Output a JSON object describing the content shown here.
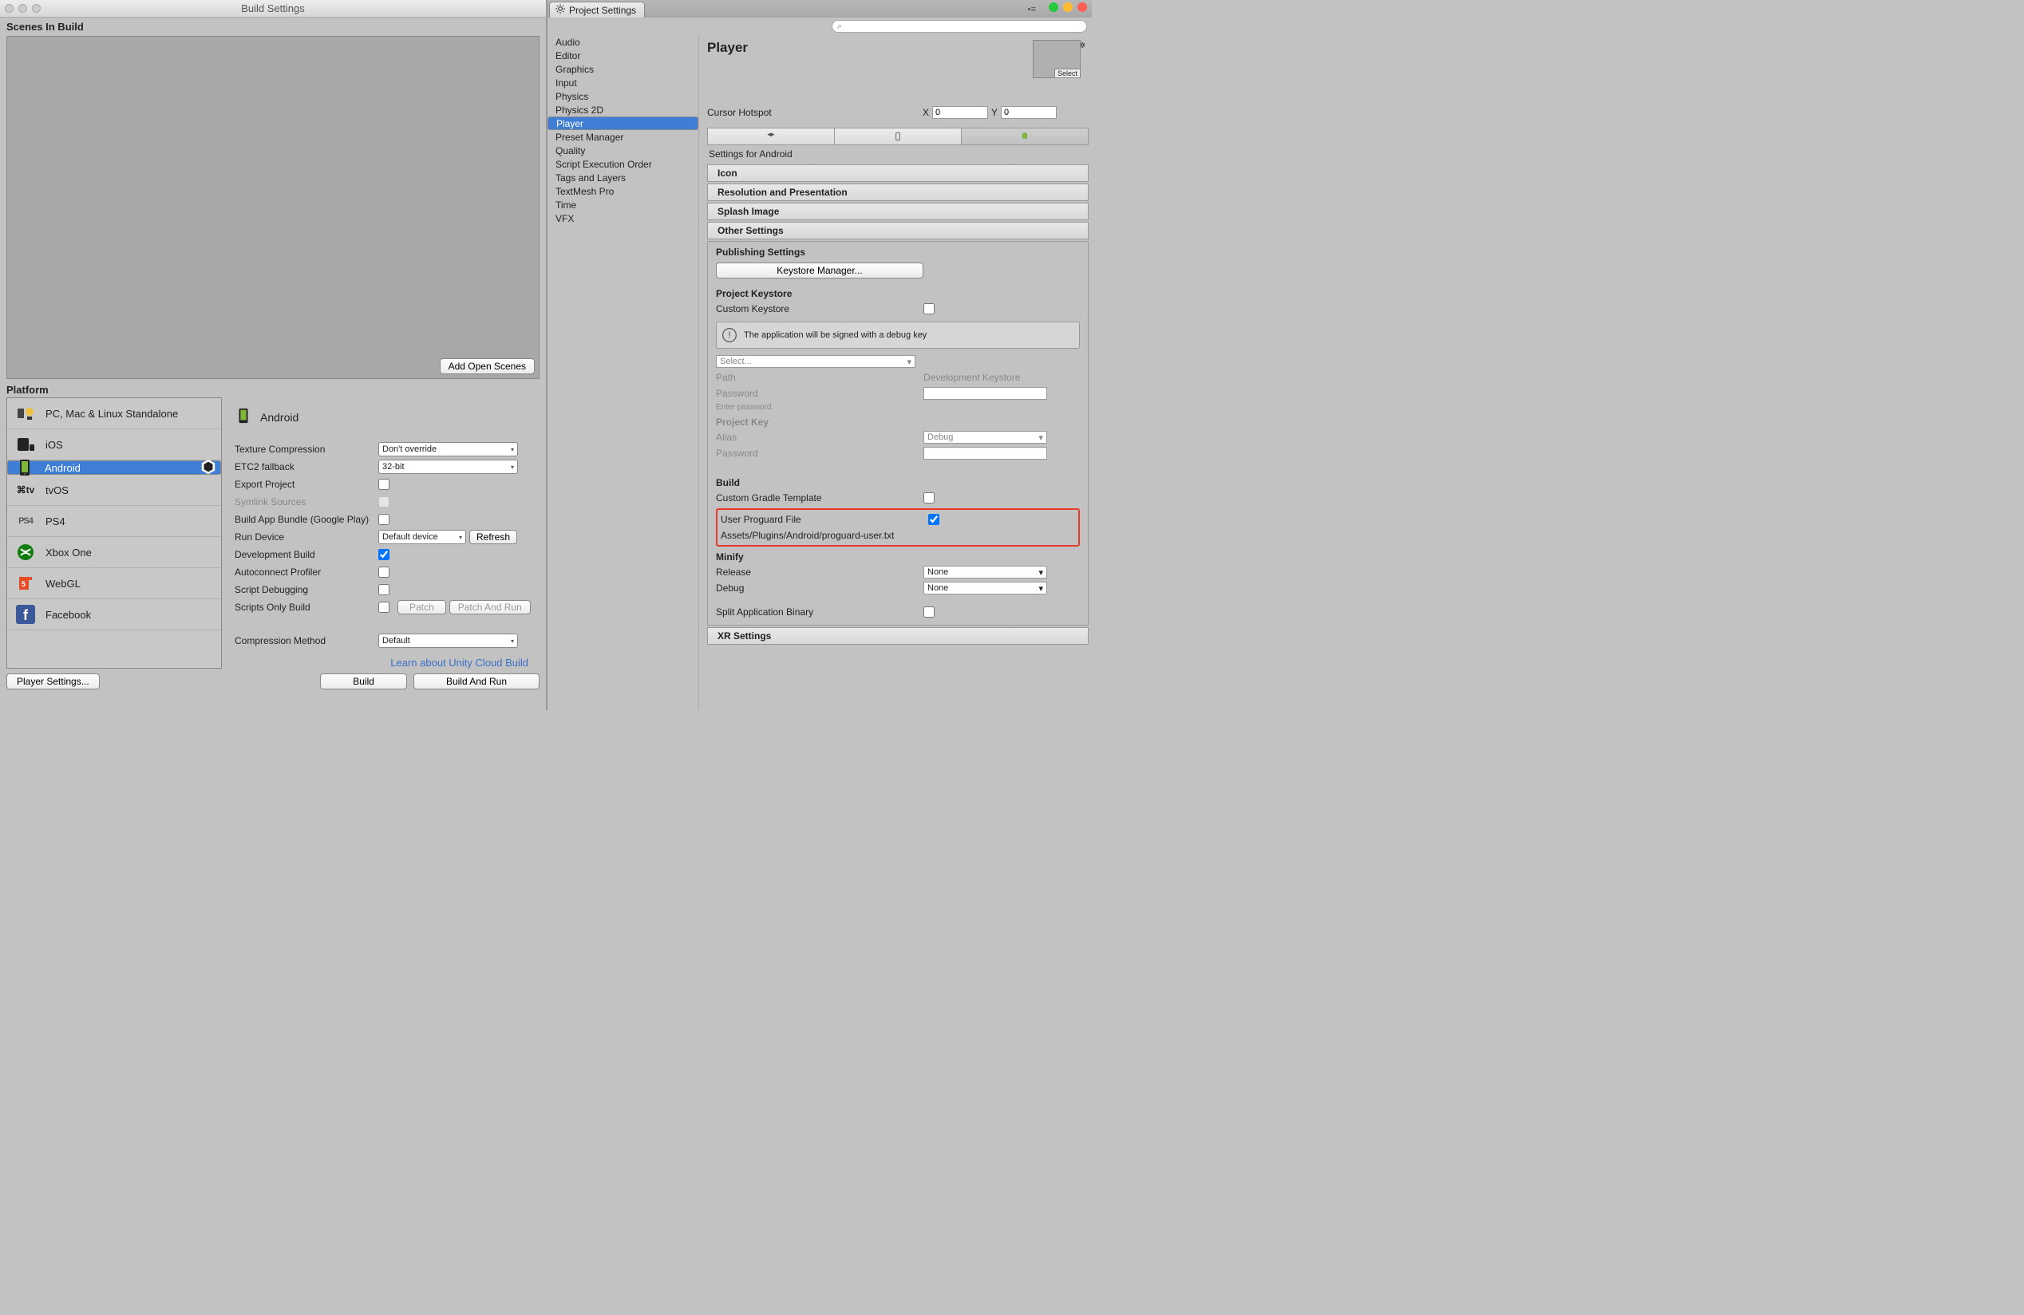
{
  "left": {
    "title": "Build Settings",
    "scenesLabel": "Scenes In Build",
    "addOpen": "Add Open Scenes",
    "platformLabel": "Platform",
    "platforms": [
      {
        "name": "PC, Mac & Linux Standalone"
      },
      {
        "name": "iOS"
      },
      {
        "name": "Android"
      },
      {
        "name": "tvOS"
      },
      {
        "name": "PS4"
      },
      {
        "name": "Xbox One"
      },
      {
        "name": "WebGL"
      },
      {
        "name": "Facebook"
      }
    ],
    "selectedPlatform": "Android",
    "opts": {
      "textureCompression": {
        "label": "Texture Compression",
        "value": "Don't override"
      },
      "etc2": {
        "label": "ETC2 fallback",
        "value": "32-bit"
      },
      "exportProject": {
        "label": "Export Project"
      },
      "symlink": {
        "label": "Symlink Sources"
      },
      "bundle": {
        "label": "Build App Bundle (Google Play)"
      },
      "runDevice": {
        "label": "Run Device",
        "value": "Default device",
        "refresh": "Refresh"
      },
      "devBuild": {
        "label": "Development Build"
      },
      "autoconnect": {
        "label": "Autoconnect Profiler"
      },
      "scriptDebug": {
        "label": "Script Debugging"
      },
      "scriptsOnly": {
        "label": "Scripts Only Build",
        "patch": "Patch",
        "patchRun": "Patch And Run"
      },
      "compression": {
        "label": "Compression Method",
        "value": "Default"
      }
    },
    "cloudLink": "Learn about Unity Cloud Build",
    "playerSettings": "Player Settings...",
    "build": "Build",
    "buildRun": "Build And Run"
  },
  "right": {
    "tabTitle": "Project Settings",
    "search": "",
    "searchIcon": "⌕",
    "categories": [
      "Audio",
      "Editor",
      "Graphics",
      "Input",
      "Physics",
      "Physics 2D",
      "Player",
      "Preset Manager",
      "Quality",
      "Script Execution Order",
      "Tags and Layers",
      "TextMesh Pro",
      "Time",
      "VFX"
    ],
    "selectedCat": "Player",
    "panelTitle": "Player",
    "selectBtn": "Select",
    "cursorHotspot": {
      "label": "Cursor Hotspot",
      "x": "0",
      "y": "0"
    },
    "settingsFor": "Settings for Android",
    "foldouts": {
      "icon": "Icon",
      "res": "Resolution and Presentation",
      "splash": "Splash Image",
      "other": "Other Settings",
      "xr": "XR Settings"
    },
    "pub": {
      "header": "Publishing Settings",
      "keystoreMgr": "Keystore Manager...",
      "projKeystore": "Project Keystore",
      "customKeystore": "Custom Keystore",
      "info": "The application will be signed with a debug key",
      "selectCombo": "Select...",
      "path": {
        "label": "Path",
        "value": "Development Keystore"
      },
      "password": "Password",
      "enterPw": "Enter password.",
      "projKey": "Project Key",
      "alias": {
        "label": "Alias",
        "value": "Debug"
      },
      "build": "Build",
      "customGradle": "Custom Gradle Template",
      "userProguard": "User Proguard File",
      "proguardPath": "Assets/Plugins/Android/proguard-user.txt",
      "minify": "Minify",
      "release": {
        "label": "Release",
        "value": "None"
      },
      "debug": {
        "label": "Debug",
        "value": "None"
      },
      "splitBinary": "Split Application Binary"
    }
  }
}
